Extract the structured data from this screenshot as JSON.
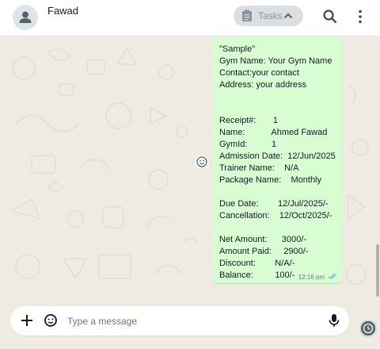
{
  "header": {
    "contact_name": "Fawad",
    "tasks_label": "Tasks"
  },
  "message": {
    "lines": [
      "\"Sample\"",
      "Gym Name: Your Gym Name",
      "Contact:your contact",
      "Address: your address",
      "",
      "",
      "Receipt#:       1",
      "Name:           Ahmed Fawad",
      "GymId:          1",
      "Admission Date:  12/Jun/2025",
      "Trainer Name:    N/A",
      "Package Name:    Monthly",
      "",
      "Due Date:        12/Jul/2025/-",
      "Cancellation:    12/Oct/2025/-",
      "",
      "Net Amount:      3000/-",
      "Amount Paid:     2900/-",
      "Discount:        N/A/-",
      "Balance:         100/-"
    ],
    "time": "12:16 pm"
  },
  "composer": {
    "placeholder": "Type a message"
  },
  "colors": {
    "bubble": "#d9fdd3",
    "background": "#efeae2",
    "read_ticks": "#53bdeb",
    "icon": "#54656f"
  },
  "icons": [
    "person-icon",
    "clipboard-icon",
    "chevron-up-icon",
    "search-icon",
    "more-vert-icon",
    "smiley-icon",
    "plus-icon",
    "sticker-icon",
    "mic-icon",
    "status-icon",
    "double-check-icon"
  ]
}
